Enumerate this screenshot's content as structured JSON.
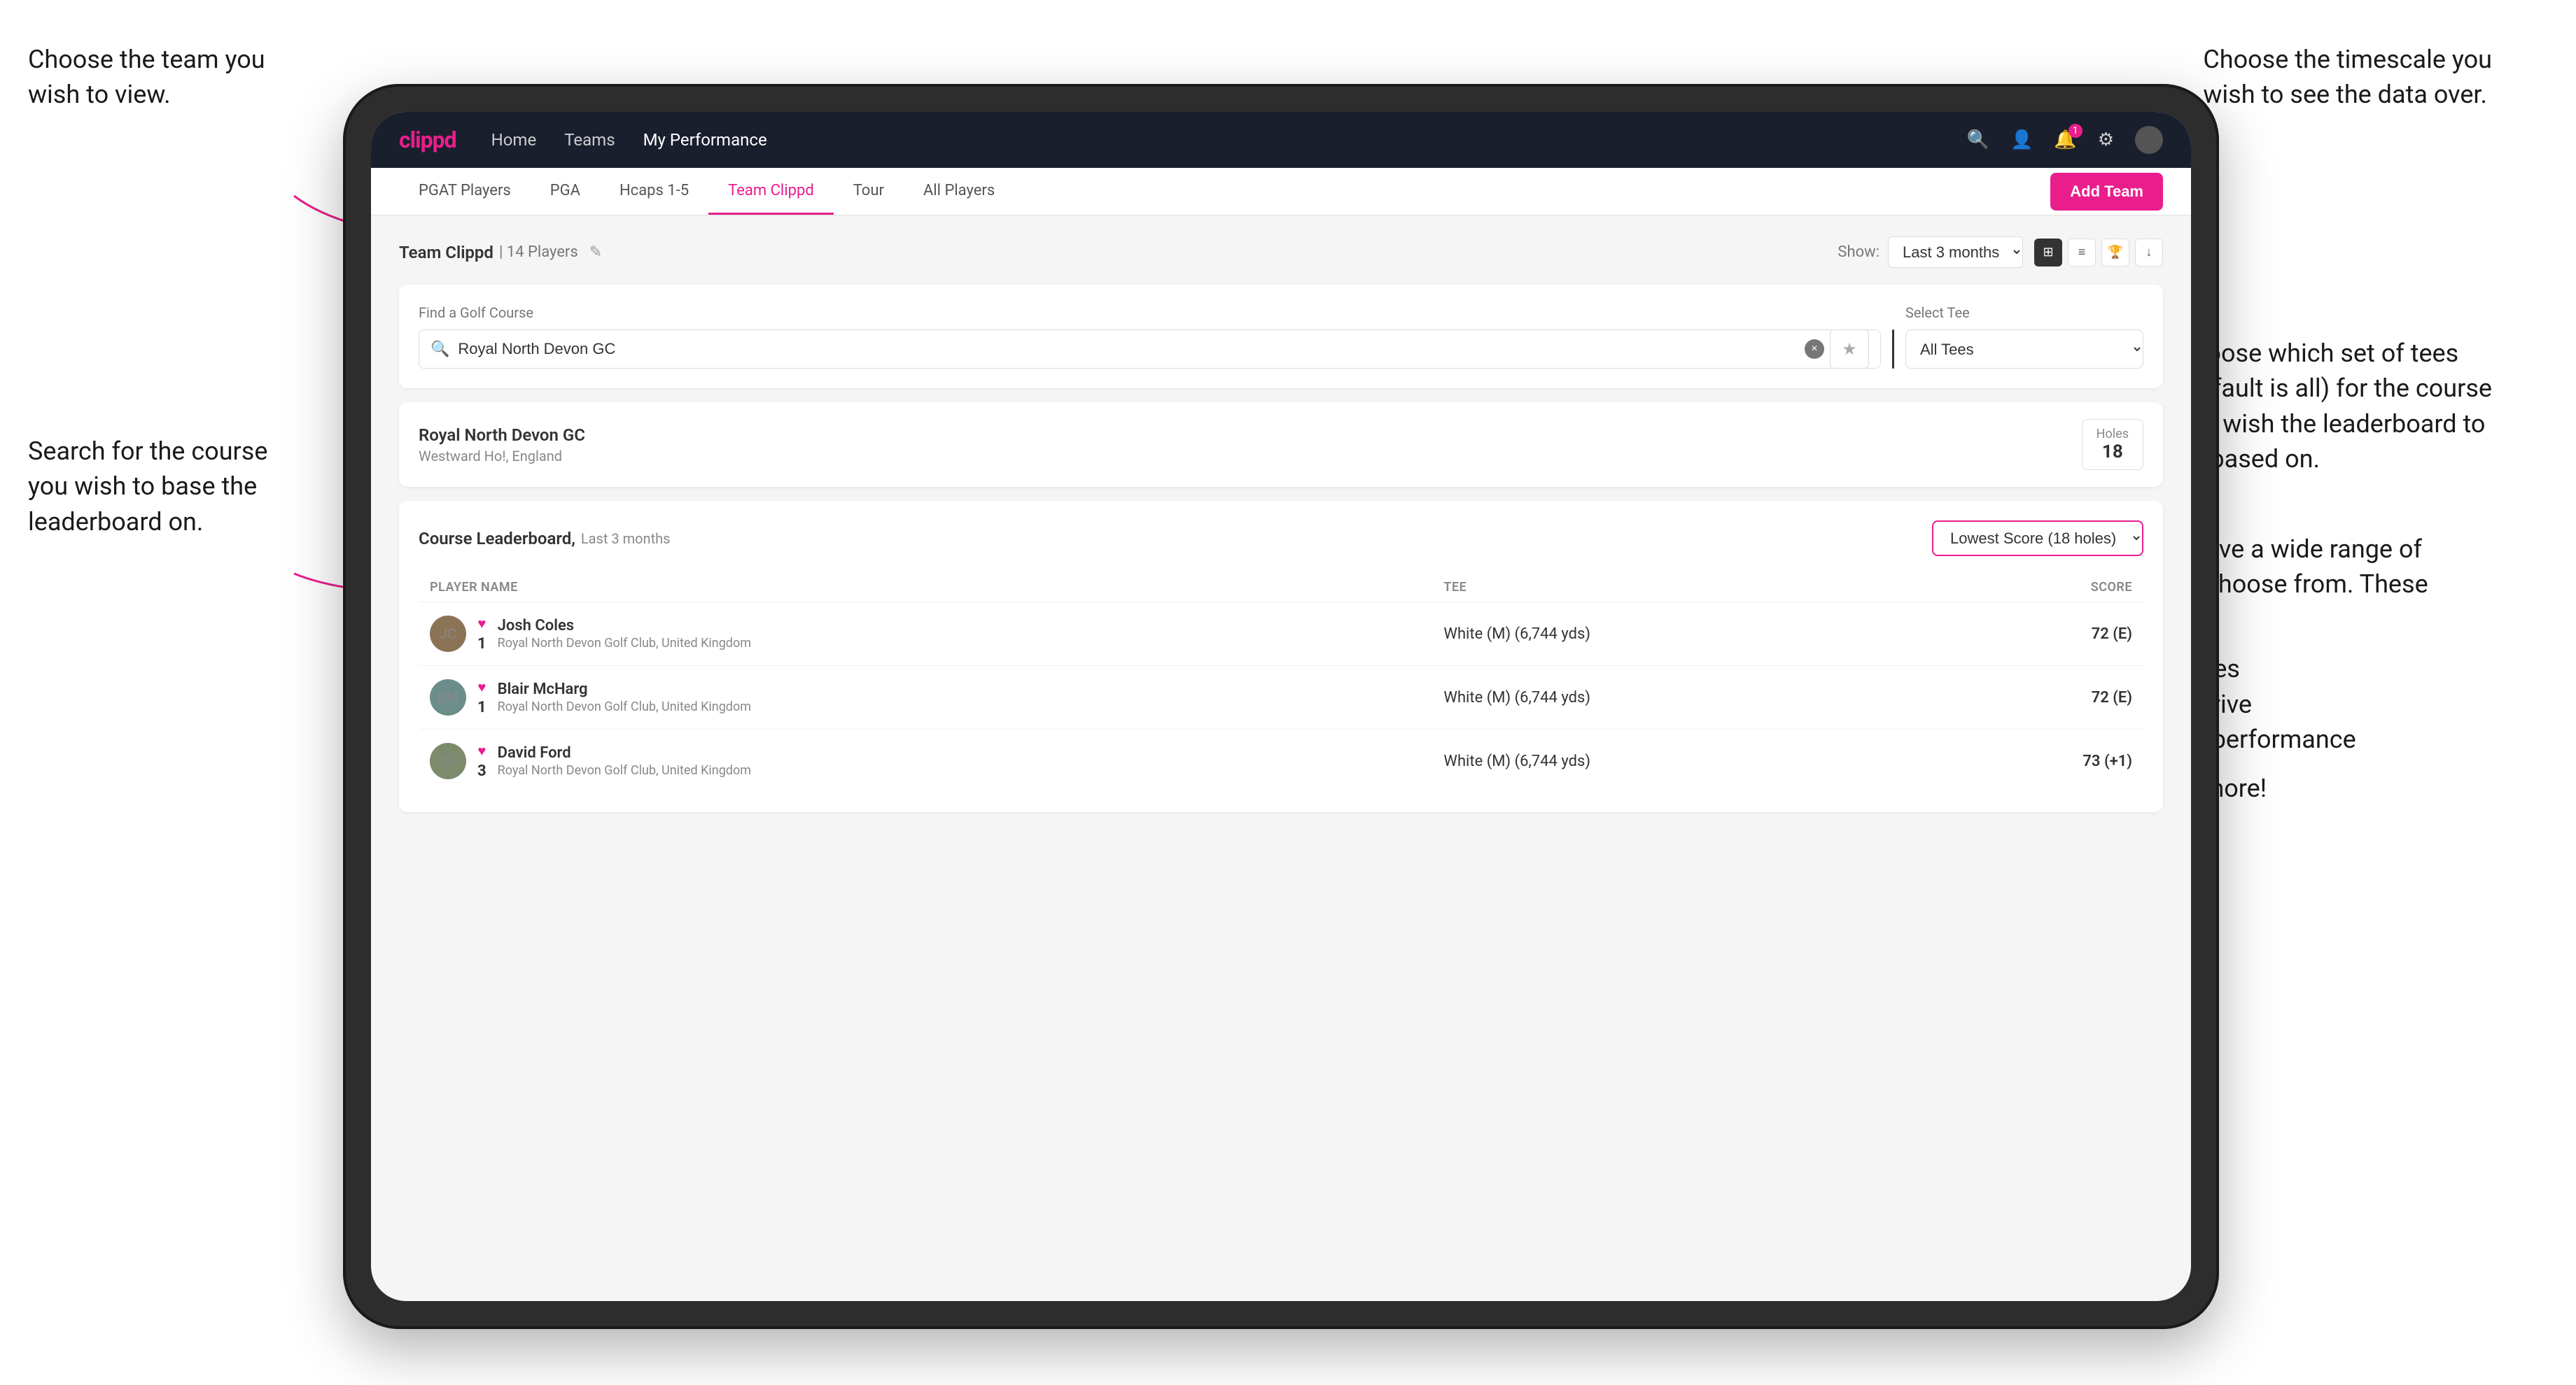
{
  "annotations": {
    "top_left": {
      "line1": "Choose the team you",
      "line2": "wish to view."
    },
    "top_right": {
      "line1": "Choose the timescale you",
      "line2": "wish to see the data over."
    },
    "mid_left": {
      "line1": "Search for the course",
      "line2": "you wish to base the",
      "line3": "leaderboard on."
    },
    "mid_right": {
      "line1": "Choose which set of tees",
      "line2": "(default is all) for the course",
      "line3": "you wish the leaderboard to",
      "line4": "be based on."
    },
    "bottom_right": {
      "intro": "Here you have a wide range of options to choose from. These include:",
      "bullet1": "Most birdies",
      "bullet2": "Longest drive",
      "bullet3": "Best APP performance",
      "suffix": "and many more!"
    }
  },
  "navbar": {
    "logo": "clippd",
    "links": [
      {
        "label": "Home",
        "active": false
      },
      {
        "label": "Teams",
        "active": false
      },
      {
        "label": "My Performance",
        "active": true
      }
    ],
    "icons": {
      "search": "🔍",
      "user": "👤",
      "bell": "🔔",
      "settings": "⚙",
      "avatar": "👤"
    }
  },
  "sub_nav": {
    "tabs": [
      {
        "label": "PGAT Players",
        "active": false
      },
      {
        "label": "PGA",
        "active": false
      },
      {
        "label": "Hcaps 1-5",
        "active": false
      },
      {
        "label": "Team Clippd",
        "active": true
      },
      {
        "label": "Tour",
        "active": false
      },
      {
        "label": "All Players",
        "active": false
      }
    ],
    "add_team_label": "Add Team"
  },
  "team_header": {
    "title": "Team Clippd",
    "count": "| 14 Players",
    "show_label": "Show:",
    "show_value": "Last 3 months",
    "edit_icon": "✎"
  },
  "search": {
    "find_course_label": "Find a Golf Course",
    "select_tee_label": "Select Tee",
    "search_value": "Royal North Devon GC",
    "tee_value": "All Tees",
    "clear_icon": "×",
    "star_icon": "★"
  },
  "course_result": {
    "name": "Royal North Devon GC",
    "location": "Westward Ho!, England",
    "holes_label": "Holes",
    "holes_count": "18"
  },
  "leaderboard": {
    "title": "Course Leaderboard,",
    "subtitle": "Last 3 months",
    "score_type": "Lowest Score (18 holes)",
    "columns": {
      "player": "PLAYER NAME",
      "tee": "TEE",
      "score": "SCORE"
    },
    "players": [
      {
        "rank": "1",
        "name": "Josh Coles",
        "club": "Royal North Devon Golf Club, United Kingdom",
        "tee": "White (M) (6,744 yds)",
        "score": "72 (E)",
        "score_class": "score-even",
        "avatar_class": "jc",
        "initials": "JC"
      },
      {
        "rank": "1",
        "name": "Blair McHarg",
        "club": "Royal North Devon Golf Club, United Kingdom",
        "tee": "White (M) (6,744 yds)",
        "score": "72 (E)",
        "score_class": "score-even",
        "avatar_class": "bm",
        "initials": "BM"
      },
      {
        "rank": "3",
        "name": "David Ford",
        "club": "Royal North Devon Golf Club, United Kingdom",
        "tee": "White (M) (6,744 yds)",
        "score": "73 (+1)",
        "score_class": "score-over",
        "avatar_class": "df",
        "initials": "DF"
      }
    ]
  }
}
